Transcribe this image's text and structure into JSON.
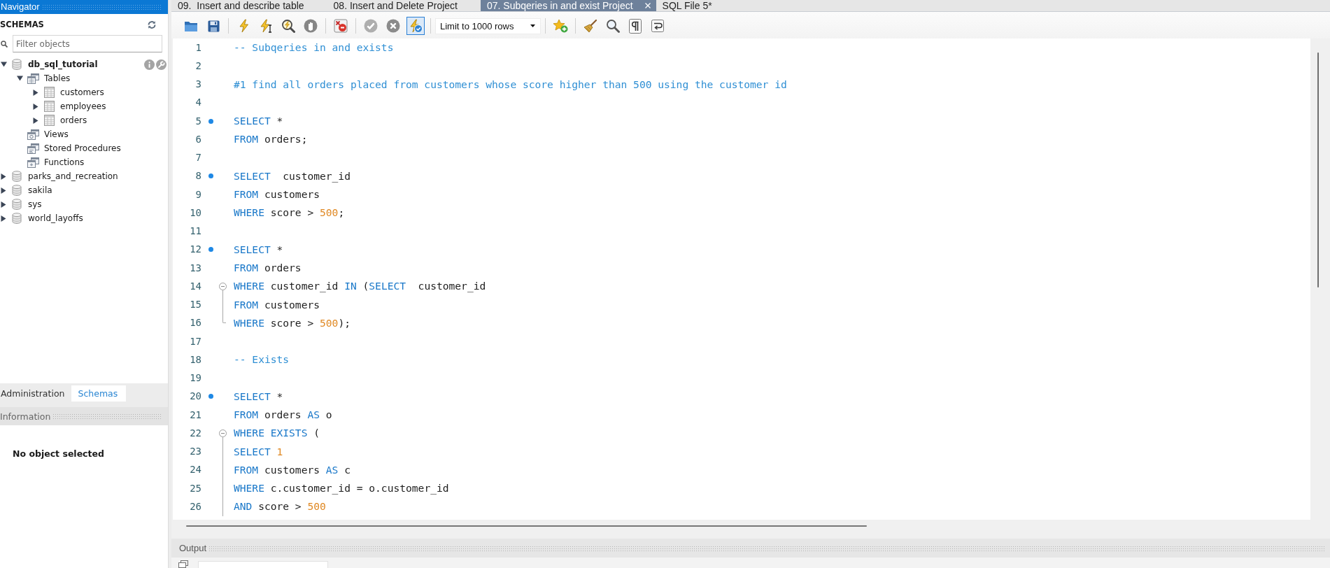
{
  "navigator": {
    "title": "Navigator",
    "section": "SCHEMAS",
    "filter": {
      "placeholder": "Filter objects"
    },
    "schemas": [
      {
        "label": "db_sql_tutorial",
        "default": true,
        "hovered": true,
        "expanded": true,
        "children": [
          {
            "label": "Tables",
            "kind": "tables",
            "expanded": true,
            "children": [
              {
                "label": "customers",
                "kind": "table",
                "expanded": false
              },
              {
                "label": "employees",
                "kind": "table",
                "expanded": false
              },
              {
                "label": "orders",
                "kind": "table",
                "expanded": false
              }
            ]
          },
          {
            "label": "Views",
            "kind": "views"
          },
          {
            "label": "Stored Procedures",
            "kind": "procedures"
          },
          {
            "label": "Functions",
            "kind": "functions"
          }
        ]
      },
      {
        "label": "parks_and_recreation",
        "default": false,
        "hovered": false,
        "expanded": false
      },
      {
        "label": "sakila",
        "default": false,
        "hovered": false,
        "expanded": false
      },
      {
        "label": "sys",
        "default": false,
        "hovered": false,
        "expanded": false
      },
      {
        "label": "world_layoffs",
        "default": false,
        "hovered": false,
        "expanded": false
      }
    ]
  },
  "navigator_tabs": [
    {
      "label": "Administration",
      "selected": false
    },
    {
      "label": "Schemas",
      "selected": true
    }
  ],
  "information": {
    "title": "Information",
    "message": "No object selected"
  },
  "editor_tabs": [
    {
      "label": "09.  Insert and describe table",
      "selected": false
    },
    {
      "label": "08. Insert and Delete Project",
      "selected": false
    },
    {
      "label": "07. Subqeries in and exist Project",
      "selected": true
    },
    {
      "label": "SQL File 5*",
      "selected": false
    }
  ],
  "toolbar": [
    {
      "kind": "open_file",
      "disabled": false
    },
    {
      "kind": "save",
      "disabled": false
    },
    {
      "kind": "separator"
    },
    {
      "kind": "execute",
      "disabled": false
    },
    {
      "kind": "execute_current",
      "disabled": false
    },
    {
      "kind": "explain",
      "disabled": false
    },
    {
      "kind": "stop",
      "disabled": true
    },
    {
      "kind": "separator"
    },
    {
      "kind": "stop_on_error",
      "disabled": false,
      "on": false
    },
    {
      "kind": "separator"
    },
    {
      "kind": "commit",
      "disabled": true
    },
    {
      "kind": "rollback",
      "disabled": true
    },
    {
      "kind": "autocommit",
      "disabled": false,
      "on": true
    },
    {
      "kind": "separator"
    },
    {
      "kind": "select",
      "value": "Limit to 1000 rows"
    },
    {
      "kind": "separator"
    },
    {
      "kind": "add_snippet",
      "disabled": false
    },
    {
      "kind": "separator"
    },
    {
      "kind": "beautify",
      "disabled": false
    },
    {
      "kind": "find",
      "disabled": false
    },
    {
      "kind": "invisible_chars",
      "disabled": false,
      "on": false
    },
    {
      "kind": "word_wrap",
      "disabled": false,
      "on": false
    }
  ],
  "editor": {
    "lines": [
      {
        "number": "1",
        "kind": "plain",
        "statement": false,
        "tokens": [
          {
            "kind": "comment",
            "text": "-- Subqeries in and exists"
          }
        ]
      },
      {
        "number": "2",
        "kind": "plain",
        "statement": false
      },
      {
        "number": "3",
        "kind": "plain",
        "statement": false,
        "tokens": [
          {
            "kind": "comment",
            "text": "#1 find all orders placed from customers whose score higher than 500 using the customer id"
          }
        ]
      },
      {
        "number": "4",
        "kind": "plain",
        "statement": false
      },
      {
        "number": "5",
        "kind": "plain",
        "statement": true,
        "tokens": [
          {
            "kind": "keyword",
            "text": "SELECT"
          },
          {
            "kind": "text",
            "text": " *"
          }
        ]
      },
      {
        "number": "6",
        "kind": "plain",
        "statement": false,
        "tokens": [
          {
            "kind": "keyword",
            "text": "FROM"
          },
          {
            "kind": "text",
            "text": " orders;"
          }
        ]
      },
      {
        "number": "7",
        "kind": "plain",
        "statement": false
      },
      {
        "number": "8",
        "kind": "plain",
        "statement": true,
        "tokens": [
          {
            "kind": "keyword",
            "text": "SELECT"
          },
          {
            "kind": "text",
            "text": "  customer_id"
          }
        ]
      },
      {
        "number": "9",
        "kind": "plain",
        "statement": false,
        "tokens": [
          {
            "kind": "keyword",
            "text": "FROM"
          },
          {
            "kind": "text",
            "text": " customers"
          }
        ]
      },
      {
        "number": "10",
        "kind": "plain",
        "statement": false,
        "tokens": [
          {
            "kind": "keyword",
            "text": "WHERE"
          },
          {
            "kind": "text",
            "text": " score > "
          },
          {
            "kind": "number",
            "text": "500"
          },
          {
            "kind": "text",
            "text": ";"
          }
        ]
      },
      {
        "number": "11",
        "kind": "plain",
        "statement": false
      },
      {
        "number": "12",
        "kind": "plain",
        "statement": true,
        "tokens": [
          {
            "kind": "keyword",
            "text": "SELECT"
          },
          {
            "kind": "text",
            "text": " *"
          }
        ]
      },
      {
        "number": "13",
        "kind": "plain",
        "statement": false,
        "tokens": [
          {
            "kind": "keyword",
            "text": "FROM"
          },
          {
            "kind": "text",
            "text": " orders"
          }
        ]
      },
      {
        "number": "14",
        "kind": "fold_start",
        "statement": false,
        "tokens": [
          {
            "kind": "keyword",
            "text": "WHERE"
          },
          {
            "kind": "text",
            "text": " customer_id "
          },
          {
            "kind": "keyword",
            "text": "IN"
          },
          {
            "kind": "text",
            "text": " ("
          },
          {
            "kind": "keyword",
            "text": "SELECT"
          },
          {
            "kind": "text",
            "text": "  customer_id"
          }
        ]
      },
      {
        "number": "15",
        "kind": "fold_body",
        "statement": false,
        "tokens": [
          {
            "kind": "keyword",
            "text": "FROM"
          },
          {
            "kind": "text",
            "text": " customers"
          }
        ]
      },
      {
        "number": "16",
        "kind": "fold_end",
        "statement": false,
        "tokens": [
          {
            "kind": "keyword",
            "text": "WHERE"
          },
          {
            "kind": "text",
            "text": " score > "
          },
          {
            "kind": "number",
            "text": "500"
          },
          {
            "kind": "text",
            "text": ");"
          }
        ]
      },
      {
        "number": "17",
        "kind": "plain",
        "statement": false
      },
      {
        "number": "18",
        "kind": "plain",
        "statement": false,
        "tokens": [
          {
            "kind": "comment",
            "text": "-- Exists"
          }
        ]
      },
      {
        "number": "19",
        "kind": "plain",
        "statement": false
      },
      {
        "number": "20",
        "kind": "plain",
        "statement": true,
        "tokens": [
          {
            "kind": "keyword",
            "text": "SELECT"
          },
          {
            "kind": "text",
            "text": " *"
          }
        ]
      },
      {
        "number": "21",
        "kind": "plain",
        "statement": false,
        "tokens": [
          {
            "kind": "keyword",
            "text": "FROM"
          },
          {
            "kind": "text",
            "text": " orders "
          },
          {
            "kind": "keyword",
            "text": "AS"
          },
          {
            "kind": "text",
            "text": " o"
          }
        ]
      },
      {
        "number": "22",
        "kind": "fold_start",
        "statement": false,
        "tokens": [
          {
            "kind": "keyword",
            "text": "WHERE EXISTS"
          },
          {
            "kind": "text",
            "text": " ("
          }
        ]
      },
      {
        "number": "23",
        "kind": "fold_body",
        "statement": false,
        "tokens": [
          {
            "kind": "keyword",
            "text": "SELECT"
          },
          {
            "kind": "number",
            "text": " 1"
          }
        ]
      },
      {
        "number": "24",
        "kind": "fold_body",
        "statement": false,
        "tokens": [
          {
            "kind": "keyword",
            "text": "FROM"
          },
          {
            "kind": "text",
            "text": " customers "
          },
          {
            "kind": "keyword",
            "text": "AS"
          },
          {
            "kind": "text",
            "text": " c"
          }
        ]
      },
      {
        "number": "25",
        "kind": "fold_body",
        "statement": false,
        "tokens": [
          {
            "kind": "keyword",
            "text": "WHERE"
          },
          {
            "kind": "text",
            "text": " c.customer_id = o.customer_id"
          }
        ]
      },
      {
        "number": "26",
        "kind": "fold_body",
        "statement": false,
        "tokens": [
          {
            "kind": "keyword",
            "text": "AND"
          },
          {
            "kind": "text",
            "text": " score > "
          },
          {
            "kind": "number",
            "text": "500"
          }
        ]
      }
    ]
  },
  "output": {
    "title": "Output"
  }
}
